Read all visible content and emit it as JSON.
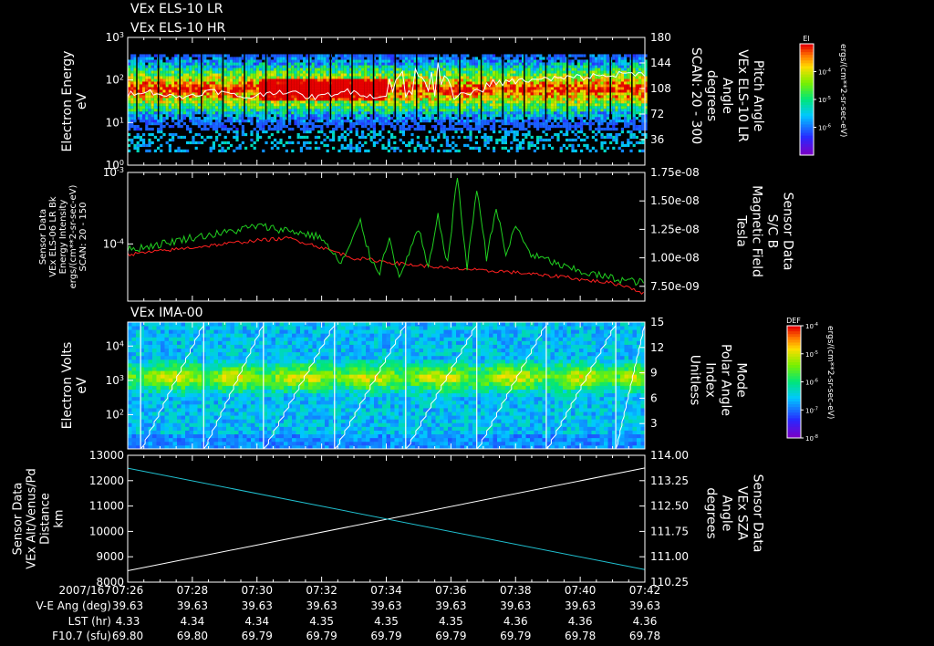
{
  "page_title": "VEx ELS-10 LR / VEx ELS-10 HR / VEx IMA-00 summary plot",
  "colors": {
    "background": "#000000",
    "foreground": "#ffffff",
    "density_red": "#ff2020",
    "magnetic_green": "#20d020",
    "sza_cyan": "#20c0d0",
    "time_marker": "#ffffff"
  },
  "chart_data": [
    {
      "id": "panel1",
      "type": "heatmap",
      "titles": [
        "VEx ELS-10 LR",
        "VEx ELS-10 HR"
      ],
      "ylabel": [
        "Electron Energy",
        "eV"
      ],
      "ylim": [
        1,
        1000
      ],
      "yscale": "log",
      "yticks": [
        {
          "label_base": "10",
          "label_exp": "0"
        },
        {
          "label_base": "10",
          "label_exp": "1"
        },
        {
          "label_base": "10",
          "label_exp": "2"
        },
        {
          "label_base": "10",
          "label_exp": "3"
        }
      ],
      "y2label": [
        "Pitch Angle",
        "VEx ELS-10 LR",
        "Angle",
        "degrees",
        "SCAN: 20 - 300"
      ],
      "y2lim": [
        0,
        180
      ],
      "y2ticks": [
        "36",
        "72",
        "108",
        "144",
        "180"
      ],
      "y2tick_values": [
        36,
        72,
        108,
        144,
        180
      ],
      "colorbar": {
        "label": "El",
        "units": "ergs/(cm**2-sr-sec-eV)",
        "ticks": [
          {
            "b": "10",
            "e": "-4"
          },
          {
            "b": "10",
            "e": "-5"
          },
          {
            "b": "10",
            "e": "-6"
          }
        ],
        "scale_top_exp": -3,
        "scale_bottom_exp": -7
      },
      "sweep_lines": 24,
      "overlay_line": "pitch-angle trace (white)"
    },
    {
      "id": "panel2",
      "type": "line",
      "ylabel": [
        "Sensor Data",
        "VEx ELS-06 LR Bk",
        "Energy Intensity",
        "ergs/(cm**2-sr-sec-eV)",
        "SCAN: 20 - 150"
      ],
      "ylim_exp": [
        -4.8,
        -3
      ],
      "yticks": [
        {
          "label_base": "10",
          "label_exp": "-4"
        },
        {
          "label_base": "10",
          "label_exp": "-3"
        }
      ],
      "y2label": [
        "Sensor Data",
        "S/C B",
        "Magnetic Field",
        "Tesla"
      ],
      "y2lim": [
        6.2e-09,
        1.75e-08
      ],
      "y2ticks": [
        "7.50e-09",
        "1.00e-08",
        "1.25e-08",
        "1.50e-08",
        "1.75e-08"
      ],
      "y2tick_values": [
        7.5e-09,
        1e-08,
        1.25e-08,
        1.5e-08,
        1.75e-08
      ],
      "series": [
        {
          "name": "Energy Intensity",
          "color": "#ff2020",
          "axis": "left",
          "x": [
            0,
            1,
            2,
            3,
            4,
            5,
            6,
            6.5,
            7,
            7.5,
            8,
            8.5,
            9,
            9.5,
            10,
            10.5,
            11,
            11.5,
            12,
            12.5,
            13,
            13.5,
            14,
            14.5,
            15,
            15.5,
            16
          ],
          "log_y": [
            -4.15,
            -4.1,
            -4.05,
            -4.0,
            -3.95,
            -3.92,
            -4.05,
            -4.12,
            -4.2,
            -4.22,
            -4.25,
            -4.28,
            -4.3,
            -4.32,
            -4.35,
            -4.35,
            -4.38,
            -4.38,
            -4.4,
            -4.42,
            -4.45,
            -4.45,
            -4.5,
            -4.52,
            -4.55,
            -4.6,
            -4.7
          ]
        },
        {
          "name": "Magnetic Field",
          "color": "#20d020",
          "axis": "right",
          "x": [
            0,
            1,
            2,
            3,
            4,
            5,
            6,
            6.3,
            6.6,
            6.9,
            7.2,
            7.5,
            7.8,
            8.1,
            8.4,
            8.7,
            9.0,
            9.3,
            9.6,
            9.9,
            10.2,
            10.5,
            10.8,
            11.1,
            11.4,
            11.7,
            12.0,
            12.5,
            13,
            13.5,
            14,
            14.5,
            15,
            15.5,
            16
          ],
          "y": [
            1.07e-08,
            1.12e-08,
            1.18e-08,
            1.22e-08,
            1.28e-08,
            1.24e-08,
            1.18e-08,
            1.05e-08,
            9.5e-09,
            1.12e-08,
            1.32e-08,
            1e-08,
            8.8e-09,
            1.2e-08,
            8e-09,
            1.05e-08,
            1.25e-08,
            9e-09,
            1.36e-08,
            9.5e-09,
            1.72e-08,
            9e-09,
            1.62e-08,
            1e-08,
            1.45e-08,
            1.02e-08,
            1.28e-08,
            1.02e-08,
            9.8e-09,
            9.2e-09,
            8.8e-09,
            8.5e-09,
            8.2e-09,
            8e-09,
            7.8e-09
          ]
        }
      ]
    },
    {
      "id": "panel3",
      "type": "heatmap",
      "titles": [
        "VEx IMA-00"
      ],
      "ylabel": [
        "Electron Volts",
        "eV"
      ],
      "ylim": [
        10,
        50000
      ],
      "yscale": "log",
      "yticks": [
        {
          "label_base": "10",
          "label_exp": "2"
        },
        {
          "label_base": "10",
          "label_exp": "3"
        },
        {
          "label_base": "10",
          "label_exp": "4"
        }
      ],
      "y2label": [
        "Mode",
        "Polar Angle",
        "Index",
        "Unitless"
      ],
      "y2lim": [
        0,
        15
      ],
      "y2ticks": [
        "3",
        "6",
        "9",
        "12",
        "15"
      ],
      "y2tick_values": [
        3,
        6,
        9,
        12,
        15
      ],
      "colorbar": {
        "label": "DEF",
        "units": "ergs/(cm**2-sr-sec-eV)",
        "ticks": [
          {
            "b": "10",
            "e": "-4"
          },
          {
            "b": "10",
            "e": "-5"
          },
          {
            "b": "10",
            "e": "-6"
          },
          {
            "b": "10",
            "e": "-7"
          },
          {
            "b": "10",
            "e": "-8"
          }
        ],
        "scale_top_exp": -4,
        "scale_bottom_exp": -8
      },
      "mode_boundaries_x": [
        0.4,
        2.35,
        4.2,
        6.4,
        8.6,
        10.8,
        12.95,
        15.1
      ]
    },
    {
      "id": "panel4",
      "type": "line",
      "ylabel": [
        "Sensor Data",
        "VEx Alt/Venus/Pd",
        "Distance",
        "km"
      ],
      "ylim": [
        8000,
        13000
      ],
      "yticks": [
        "8000",
        "9000",
        "10000",
        "11000",
        "12000",
        "13000"
      ],
      "ytick_values": [
        8000,
        9000,
        10000,
        11000,
        12000,
        13000
      ],
      "y2label": [
        "Sensor Data",
        "VEx SZA",
        "Angle",
        "degrees"
      ],
      "y2lim": [
        110.25,
        114.0
      ],
      "y2ticks": [
        "110.25",
        "111.00",
        "111.75",
        "112.50",
        "113.25",
        "114.00"
      ],
      "y2tick_values": [
        110.25,
        111.0,
        111.75,
        112.5,
        113.25,
        114.0
      ],
      "series": [
        {
          "name": "Distance",
          "color": "#ffffff",
          "axis": "left",
          "x": [
            0,
            16
          ],
          "y": [
            8450,
            12500
          ]
        },
        {
          "name": "SZA",
          "color": "#20c0d0",
          "axis": "right",
          "x": [
            0,
            16
          ],
          "y": [
            113.62,
            110.62
          ]
        }
      ]
    }
  ],
  "time_axis": {
    "xlim_minutes": [
      0,
      16
    ],
    "rows": [
      {
        "label": "2007/167",
        "values": [
          "07:26",
          "07:28",
          "07:30",
          "07:32",
          "07:34",
          "07:36",
          "07:38",
          "07:40",
          "07:42"
        ]
      },
      {
        "label": "V-E Ang (deg)",
        "values": [
          "39.63",
          "39.63",
          "39.63",
          "39.63",
          "39.63",
          "39.63",
          "39.63",
          "39.63",
          "39.63"
        ]
      },
      {
        "label": "LST (hr)",
        "values": [
          "4.33",
          "4.34",
          "4.34",
          "4.35",
          "4.35",
          "4.35",
          "4.36",
          "4.36",
          "4.36"
        ]
      },
      {
        "label": "F10.7 (sfu)",
        "values": [
          "69.80",
          "69.80",
          "69.79",
          "69.79",
          "69.79",
          "69.79",
          "69.79",
          "69.78",
          "69.78"
        ]
      }
    ]
  }
}
